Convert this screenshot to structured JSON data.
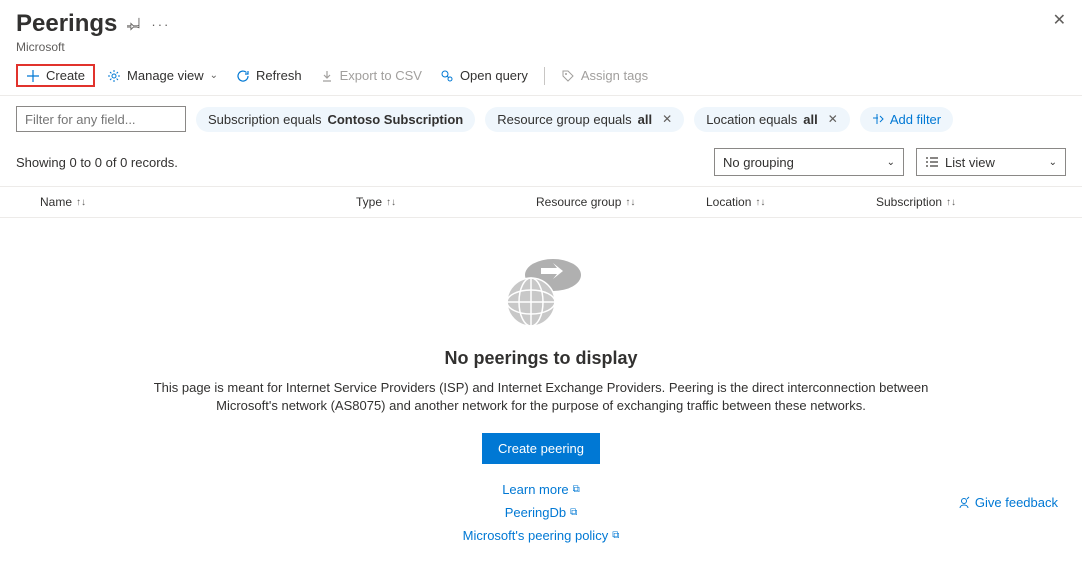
{
  "header": {
    "title": "Peerings",
    "subtitle": "Microsoft"
  },
  "toolbar": {
    "create": "Create",
    "manage_view": "Manage view",
    "refresh": "Refresh",
    "export_csv": "Export to CSV",
    "open_query": "Open query",
    "assign_tags": "Assign tags"
  },
  "filters": {
    "placeholder": "Filter for any field...",
    "subscription_prefix": "Subscription equals ",
    "subscription_value": "Contoso Subscription",
    "rg_prefix": "Resource group equals ",
    "rg_value": "all",
    "loc_prefix": "Location equals ",
    "loc_value": "all",
    "add_filter": "Add filter"
  },
  "status": {
    "records": "Showing 0 to 0 of 0 records.",
    "grouping": "No grouping",
    "view": "List view"
  },
  "columns": {
    "name": "Name",
    "type": "Type",
    "rg": "Resource group",
    "loc": "Location",
    "sub": "Subscription"
  },
  "empty": {
    "title": "No peerings to display",
    "desc": "This page is meant for Internet Service Providers (ISP) and Internet Exchange Providers. Peering is the direct interconnection between Microsoft's network (AS8075) and another network for the purpose of exchanging traffic between these networks.",
    "button": "Create peering",
    "learn_more": "Learn more",
    "peeringdb": "PeeringDb",
    "policy": "Microsoft's peering policy"
  },
  "feedback": "Give feedback"
}
